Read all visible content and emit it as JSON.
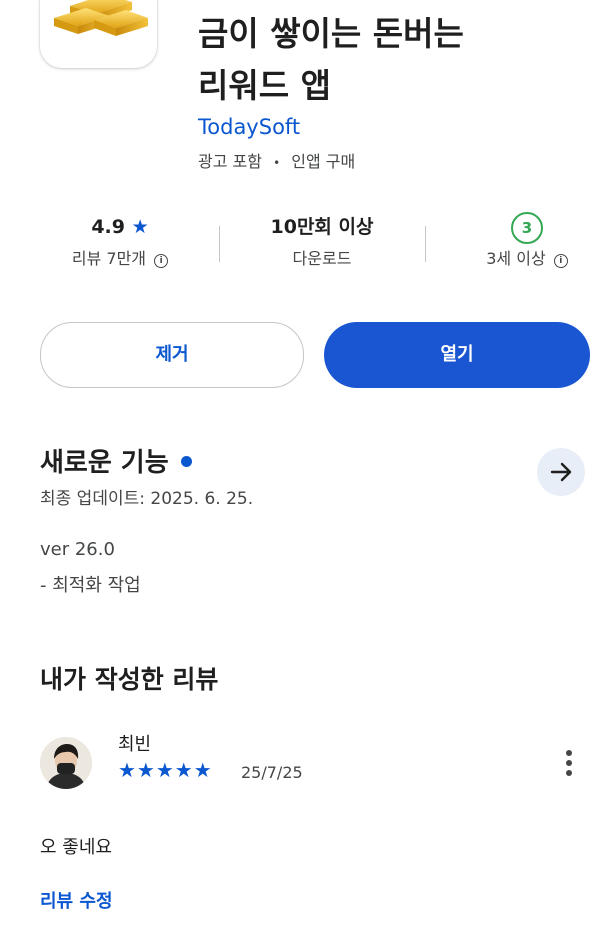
{
  "app": {
    "title_line1": "금이 쌓이는 돈버는",
    "title_line2": "리워드 앱",
    "developer": "TodaySoft",
    "ads_label": "광고 포함",
    "separator": "•",
    "iap_label": "인앱 구매"
  },
  "stats": {
    "rating": "4.9",
    "rating_star": "★",
    "reviews_label": "리뷰 7만개",
    "downloads": "10만회 이상",
    "downloads_label": "다운로드",
    "age_badge": "3",
    "age_label": "3세 이상",
    "info_glyph": "i"
  },
  "actions": {
    "uninstall_label": "제거",
    "open_label": "열기"
  },
  "whats_new": {
    "title": "새로운 기능",
    "last_updated": "최종 업데이트: 2025. 6. 25.",
    "version": "ver 26.0",
    "note": "- 최적화 작업"
  },
  "my_review": {
    "section_title": "내가 작성한 리뷰",
    "reviewer": "최빈",
    "rating_stars": 5,
    "stars_text": "★★★★★",
    "date": "25/7/25",
    "text": "오 좋네요",
    "edit_label": "리뷰 수정"
  },
  "colors": {
    "accent": "#0b57d0",
    "primary_button": "#1a56d1",
    "age_badge_green": "#34a853",
    "text_primary": "#1f1f1f",
    "text_secondary": "#444746"
  },
  "icons": {
    "app_icon": "gold-bars-icon",
    "arrow": "arrow-right-icon",
    "more": "more-vert-icon",
    "info": "info-icon",
    "star": "star-icon"
  }
}
